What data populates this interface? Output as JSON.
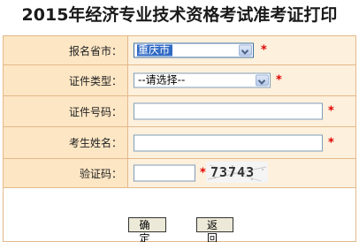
{
  "page": {
    "title": "2015年经济专业技术资格考试准考证打印"
  },
  "form": {
    "province": {
      "label": "报名省市：",
      "selected": "重庆市",
      "required_mark": "*"
    },
    "id_type": {
      "label": "证件类型：",
      "selected": "--请选择--",
      "required_mark": "*"
    },
    "id_number": {
      "label": "证件号码：",
      "value": "",
      "required_mark": "*"
    },
    "name": {
      "label": "考生姓名：",
      "value": "",
      "required_mark": "*"
    },
    "captcha": {
      "label": "验证码：",
      "value": "",
      "required_mark": "*",
      "image_text": "73743"
    }
  },
  "buttons": {
    "confirm_label": "确 定",
    "back_label": "返 回"
  },
  "colors": {
    "label_bg": "#fde6c4",
    "value_bg": "#fdf0dc",
    "border": "#e3b98a",
    "required": "#e00000",
    "selection_highlight": "#316ac5"
  }
}
